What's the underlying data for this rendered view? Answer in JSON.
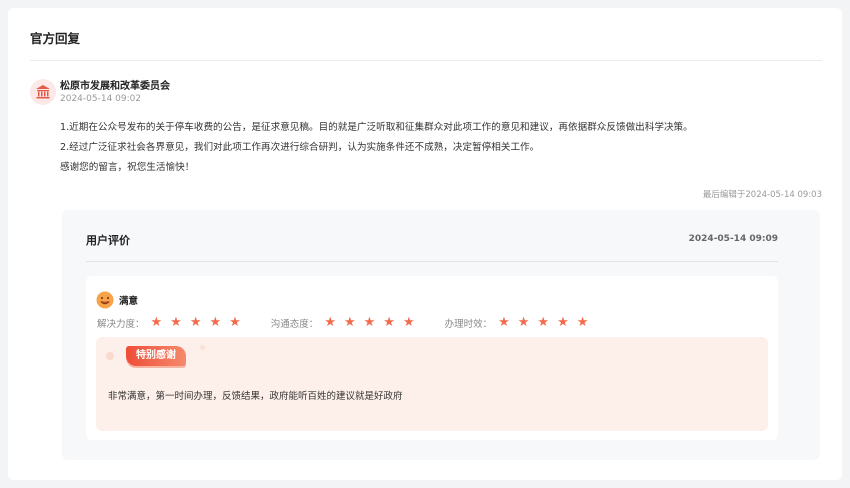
{
  "section": {
    "title": "官方回复"
  },
  "reply": {
    "org_name": "松原市发展和改革委员会",
    "time": "2024-05-14 09:02",
    "paragraphs": [
      "1.近期在公众号发布的关于停车收费的公告，是征求意见稿。目的就是广泛听取和征集群众对此项工作的意见和建议，再依据群众反馈做出科学决策。",
      "2.经过广泛征求社会各界意见，我们对此项工作再次进行综合研判，认为实施条件还不成熟，决定暂停相关工作。",
      "感谢您的留言，祝您生活愉快！"
    ],
    "edited": "最后编辑于2024-05-14 09:03",
    "avatar_icon": "government-building-icon"
  },
  "evaluation": {
    "title": "用户评价",
    "time": "2024-05-14 09:09",
    "satisfaction": "满意",
    "satisfaction_icon": "smiley-face-icon",
    "ratings": [
      {
        "label": "解决力度：",
        "stars": 5
      },
      {
        "label": "沟通态度：",
        "stars": 5
      },
      {
        "label": "办理时效：",
        "stars": 5
      }
    ],
    "thanks_tag": "特别感谢",
    "thanks_text": "非常满意，第一时间办理，反馈结果，政府能听百姓的建议就是好政府"
  },
  "colors": {
    "accent": "#f26b4c",
    "tag_start": "#ef4d38",
    "tag_end": "#f58a6c",
    "thanks_bg": "#fdf0ea",
    "panel_bg": "#f7f8fa"
  }
}
